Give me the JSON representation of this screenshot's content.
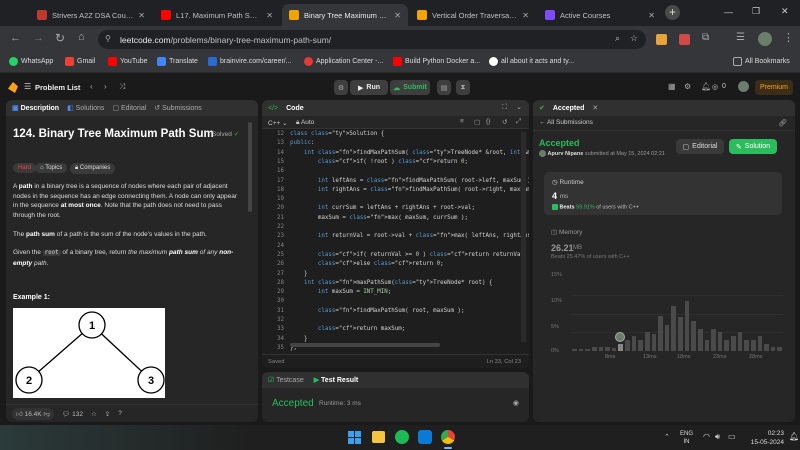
{
  "browser": {
    "tabs": [
      {
        "title": "Strivers A2Z DSA Course/S",
        "fav": "#c0392b"
      },
      {
        "title": "L17. Maximum Path Sum in",
        "fav": "#ff0000"
      },
      {
        "title": "Binary Tree Maximum Path",
        "fav": "#f0a500"
      },
      {
        "title": "Vertical Order Traversal of",
        "fav": "#f0a500"
      },
      {
        "title": "Active Courses",
        "fav": "#7c4dff"
      }
    ],
    "url_host": "leetcode.com",
    "url_path": "/problems/binary-tree-maximum-path-sum/",
    "bookmarks": [
      "WhatsApp",
      "Gmail",
      "YouTube",
      "Translate",
      "brainvire.com/career/...",
      "Application Center -...",
      "Build Python Docker a...",
      "all about it acts and ty..."
    ],
    "all_bookmarks": "All Bookmarks"
  },
  "leetcode": {
    "problem_list": "Problem List",
    "run": "Run",
    "submit": "Submit",
    "coins": "0",
    "premium": "Premium"
  },
  "left": {
    "tabs": [
      "Description",
      "Solutions",
      "Editorial",
      "Submissions"
    ],
    "title": "124. Binary Tree Maximum Path Sum",
    "solved": "Solved",
    "difficulty": "Hard",
    "topics": "Topics",
    "companies": "Companies",
    "p1_a": "A ",
    "p1_b": "path",
    "p1_c": " in a binary tree is a sequence of nodes where each pair of adjacent nodes in the sequence has an edge connecting them. A node can only appear in the sequence ",
    "p1_d": "at most once",
    "p1_e": ". Note that the path does not need to pass through the root.",
    "p2_a": "The ",
    "p2_b": "path sum",
    "p2_c": " of a path is the sum of the node's values in the path.",
    "p3_a": "Given the ",
    "p3_b": "root",
    "p3_c": " of a binary tree, return ",
    "p3_d": "the maximum ",
    "p3_e": "path sum",
    "p3_f": " of any ",
    "p3_g": "non-empty",
    "p3_h": " path",
    "example": "Example 1:",
    "tree": {
      "root": "1",
      "left": "2",
      "right": "3"
    },
    "likes": "16.4K",
    "comments": "132"
  },
  "code": {
    "title": "Code",
    "lang": "C++",
    "auto": "Auto",
    "status_left": "Saved",
    "status_right": "Ln 33, Col 23",
    "lines": [
      {
        "n": "12",
        "t": "class Solution {"
      },
      {
        "n": "13",
        "t": "public:"
      },
      {
        "n": "14",
        "t": "    int findMaxPathSum( TreeNode* &root, int &maxSum ){"
      },
      {
        "n": "15",
        "t": "        if( !root ) return 0;"
      },
      {
        "n": "16",
        "t": ""
      },
      {
        "n": "17",
        "t": "        int leftAns = findMaxPathSum( root->left, maxSum );"
      },
      {
        "n": "18",
        "t": "        int rightAns = findMaxPathSum( root->right, maxSum );"
      },
      {
        "n": "19",
        "t": ""
      },
      {
        "n": "20",
        "t": "        int currSum = leftAns + rightAns + root->val;"
      },
      {
        "n": "21",
        "t": "        maxSum = max( maxSum, currSum );"
      },
      {
        "n": "22",
        "t": ""
      },
      {
        "n": "23",
        "t": "        int returnVal = root->val + max( leftAns, rightAns );"
      },
      {
        "n": "24",
        "t": ""
      },
      {
        "n": "25",
        "t": "        if( returnVal >= 0 ) return returnVal;"
      },
      {
        "n": "26",
        "t": "        else return 0;"
      },
      {
        "n": "27",
        "t": "    }"
      },
      {
        "n": "28",
        "t": "    int maxPathSum(TreeNode* root) {"
      },
      {
        "n": "29",
        "t": "        int maxSum = INT_MIN;"
      },
      {
        "n": "30",
        "t": ""
      },
      {
        "n": "31",
        "t": "        findMaxPathSum( root, maxSum );"
      },
      {
        "n": "32",
        "t": ""
      },
      {
        "n": "33",
        "t": "        return maxSum;"
      },
      {
        "n": "34",
        "t": "    }"
      },
      {
        "n": "35",
        "t": "};"
      }
    ]
  },
  "result": {
    "testcase_tab": "Testcase",
    "result_tab": "Test Result",
    "accepted": "Accepted",
    "runtime": "Runtime: 3 ms"
  },
  "accepted_panel": {
    "tab": "Accepted",
    "all_submissions": "All Submissions",
    "status": "Accepted",
    "author": "Apurv Nipane",
    "submitted": "submitted at May 15, 2024 02:21",
    "editorial": "Editorial",
    "solution": "Solution",
    "runtime_label": "Runtime",
    "runtime_value": "4",
    "runtime_unit": "ms",
    "beats_label": "Beats",
    "runtime_beats": "99.91%",
    "runtime_beats_suffix": "of users with C++",
    "memory_label": "Memory",
    "memory_value": "26.21",
    "memory_unit": "MB",
    "memory_beats": "Beats 25.47% of users with C++"
  },
  "chart_data": {
    "type": "bar",
    "y_ticks": [
      "15%",
      "10%",
      "5%",
      "0%"
    ],
    "x_ticks": [
      "8ms",
      "13ms",
      "18ms",
      "23ms",
      "28ms"
    ],
    "ylim": [
      0,
      20
    ],
    "values": [
      0.5,
      0.5,
      0.5,
      1.2,
      1,
      1.2,
      0.8,
      2,
      3,
      4,
      3,
      5,
      4.5,
      9.5,
      7,
      12,
      9,
      13.5,
      8,
      6,
      3,
      6,
      5,
      3,
      4,
      5,
      3,
      3,
      4,
      2,
      1,
      1
    ],
    "highlight_index": 7
  },
  "taskbar": {
    "lang": "ENG",
    "region": "IN",
    "time": "02:23",
    "date": "15-05-2024"
  },
  "colors": {
    "accepted": "#2cbb5d",
    "hard": "#ef4743",
    "run_bg": "#3e3e3e",
    "premium": "#ffa116"
  }
}
